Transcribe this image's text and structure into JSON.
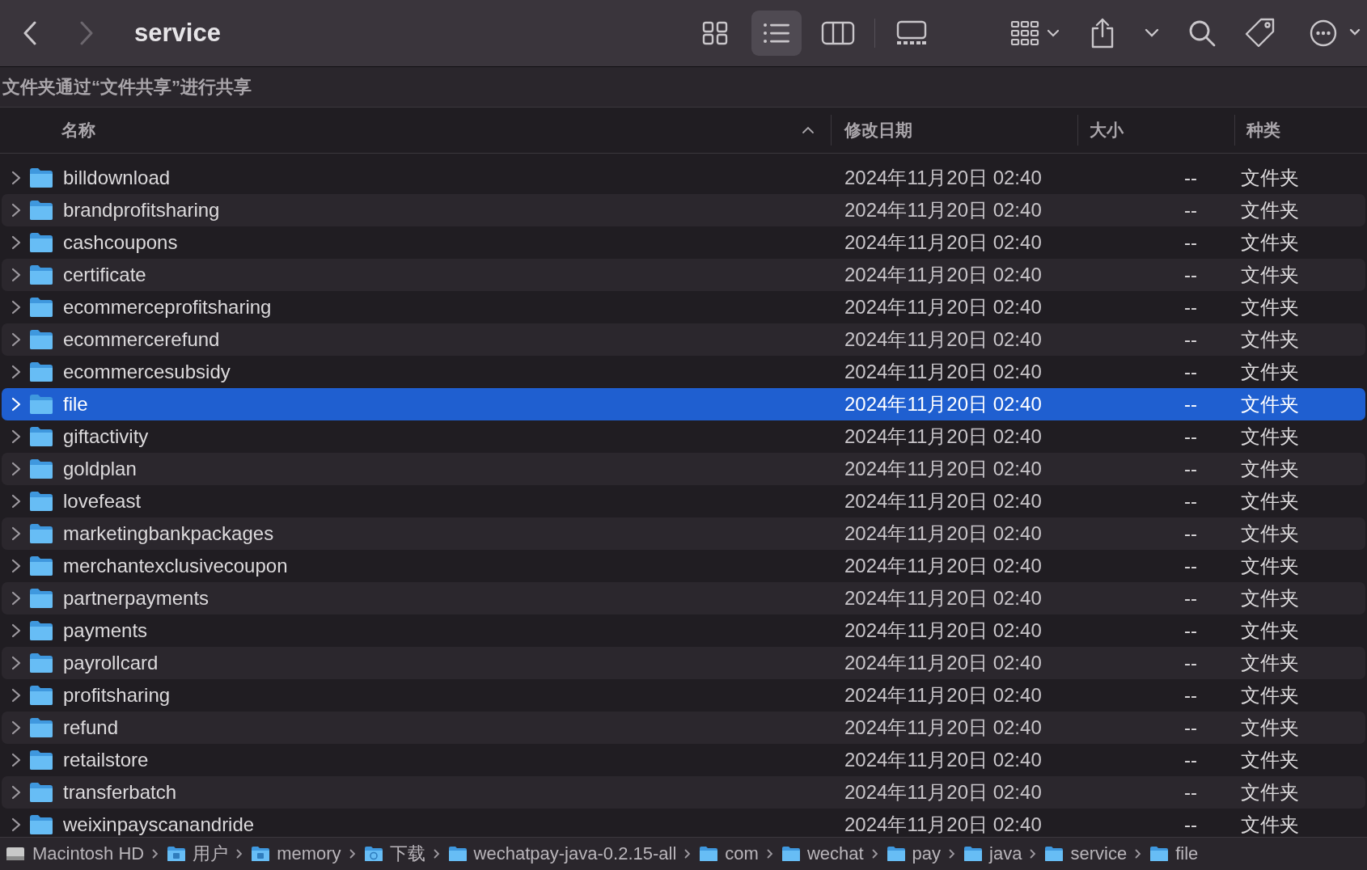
{
  "toolbar": {
    "back_enabled": true,
    "forward_enabled": false,
    "title": "service",
    "views": [
      {
        "kind": "icons",
        "selected": false
      },
      {
        "kind": "list",
        "selected": true
      },
      {
        "kind": "columns",
        "selected": false
      },
      {
        "kind": "gallery",
        "selected": false
      }
    ]
  },
  "info_bar": "文件夹通过“文件共享”进行共享",
  "columns": [
    {
      "label": "名称",
      "sorted": true
    },
    {
      "label": "修改日期",
      "sorted": false
    },
    {
      "label": "大小",
      "sorted": false
    },
    {
      "label": "种类",
      "sorted": false
    }
  ],
  "rows": [
    {
      "name": "billdownload",
      "date": "2024年11月20日 02:40",
      "size": "--",
      "kind": "文件夹",
      "selected": false
    },
    {
      "name": "brandprofitsharing",
      "date": "2024年11月20日 02:40",
      "size": "--",
      "kind": "文件夹",
      "selected": false
    },
    {
      "name": "cashcoupons",
      "date": "2024年11月20日 02:40",
      "size": "--",
      "kind": "文件夹",
      "selected": false
    },
    {
      "name": "certificate",
      "date": "2024年11月20日 02:40",
      "size": "--",
      "kind": "文件夹",
      "selected": false
    },
    {
      "name": "ecommerceprofitsharing",
      "date": "2024年11月20日 02:40",
      "size": "--",
      "kind": "文件夹",
      "selected": false
    },
    {
      "name": "ecommercerefund",
      "date": "2024年11月20日 02:40",
      "size": "--",
      "kind": "文件夹",
      "selected": false
    },
    {
      "name": "ecommercesubsidy",
      "date": "2024年11月20日 02:40",
      "size": "--",
      "kind": "文件夹",
      "selected": false
    },
    {
      "name": "file",
      "date": "2024年11月20日 02:40",
      "size": "--",
      "kind": "文件夹",
      "selected": true
    },
    {
      "name": "giftactivity",
      "date": "2024年11月20日 02:40",
      "size": "--",
      "kind": "文件夹",
      "selected": false
    },
    {
      "name": "goldplan",
      "date": "2024年11月20日 02:40",
      "size": "--",
      "kind": "文件夹",
      "selected": false
    },
    {
      "name": "lovefeast",
      "date": "2024年11月20日 02:40",
      "size": "--",
      "kind": "文件夹",
      "selected": false
    },
    {
      "name": "marketingbankpackages",
      "date": "2024年11月20日 02:40",
      "size": "--",
      "kind": "文件夹",
      "selected": false
    },
    {
      "name": "merchantexclusivecoupon",
      "date": "2024年11月20日 02:40",
      "size": "--",
      "kind": "文件夹",
      "selected": false
    },
    {
      "name": "partnerpayments",
      "date": "2024年11月20日 02:40",
      "size": "--",
      "kind": "文件夹",
      "selected": false
    },
    {
      "name": "payments",
      "date": "2024年11月20日 02:40",
      "size": "--",
      "kind": "文件夹",
      "selected": false
    },
    {
      "name": "payrollcard",
      "date": "2024年11月20日 02:40",
      "size": "--",
      "kind": "文件夹",
      "selected": false
    },
    {
      "name": "profitsharing",
      "date": "2024年11月20日 02:40",
      "size": "--",
      "kind": "文件夹",
      "selected": false
    },
    {
      "name": "refund",
      "date": "2024年11月20日 02:40",
      "size": "--",
      "kind": "文件夹",
      "selected": false
    },
    {
      "name": "retailstore",
      "date": "2024年11月20日 02:40",
      "size": "--",
      "kind": "文件夹",
      "selected": false
    },
    {
      "name": "transferbatch",
      "date": "2024年11月20日 02:40",
      "size": "--",
      "kind": "文件夹",
      "selected": false
    },
    {
      "name": "weixinpayscanandride",
      "date": "2024年11月20日 02:40",
      "size": "--",
      "kind": "文件夹",
      "selected": false
    }
  ],
  "path_bar": [
    {
      "label": "Macintosh HD",
      "kind": "disk"
    },
    {
      "label": "用户",
      "kind": "home"
    },
    {
      "label": "memory",
      "kind": "home"
    },
    {
      "label": "下载",
      "kind": "downloads"
    },
    {
      "label": "wechatpay-java-0.2.15-all",
      "kind": "folder"
    },
    {
      "label": "com",
      "kind": "folder"
    },
    {
      "label": "wechat",
      "kind": "folder"
    },
    {
      "label": "pay",
      "kind": "folder"
    },
    {
      "label": "java",
      "kind": "folder"
    },
    {
      "label": "service",
      "kind": "folder"
    },
    {
      "label": "file",
      "kind": "folder"
    }
  ]
}
